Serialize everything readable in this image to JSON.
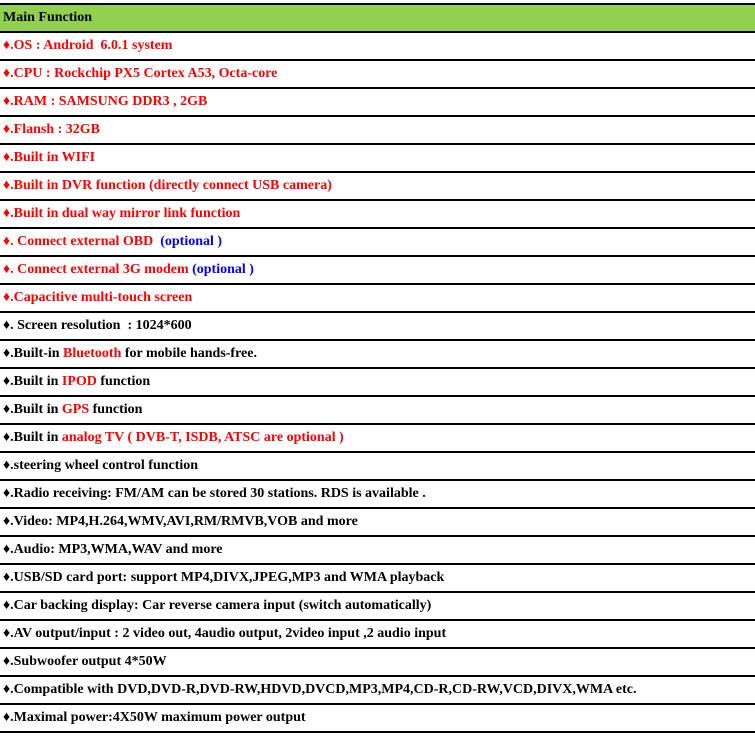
{
  "header": {
    "title": "Main Function",
    "background": "#92d050"
  },
  "colors": {
    "red": "#ff0000",
    "blue": "#0000ff",
    "black": "#000000"
  },
  "bullet": "♦",
  "rows": [
    {
      "segments": [
        {
          "text": "♦.OS : Android  6.0.1 system",
          "color": "red"
        }
      ]
    },
    {
      "segments": [
        {
          "text": "♦.CPU : Rockchip PX5 Cortex A53, Octa-core",
          "color": "red"
        }
      ]
    },
    {
      "segments": [
        {
          "text": "♦.RAM : SAMSUNG DDR3 , 2GB",
          "color": "red"
        }
      ]
    },
    {
      "segments": [
        {
          "text": "♦.Flansh : 32GB",
          "color": "red"
        }
      ]
    },
    {
      "segments": [
        {
          "text": "♦.Built in WIFI",
          "color": "red"
        }
      ]
    },
    {
      "segments": [
        {
          "text": "♦.Built in DVR function (directly connect USB camera)",
          "color": "red"
        }
      ]
    },
    {
      "segments": [
        {
          "text": "♦.Built in dual way mirror link function",
          "color": "red"
        }
      ]
    },
    {
      "segments": [
        {
          "text": "♦. Connect external OBD  ",
          "color": "red"
        },
        {
          "text": "(optional )",
          "color": "blue"
        }
      ]
    },
    {
      "segments": [
        {
          "text": "♦. Connect external 3G modem ",
          "color": "red"
        },
        {
          "text": "(optional )",
          "color": "blue"
        }
      ]
    },
    {
      "segments": [
        {
          "text": "♦.Capacitive multi-touch screen",
          "color": "red"
        }
      ]
    },
    {
      "segments": [
        {
          "text": "♦. Screen resolution  : 1024*600",
          "color": "black"
        }
      ]
    },
    {
      "segments": [
        {
          "text": "♦.Built-in ",
          "color": "black"
        },
        {
          "text": "Bluetooth",
          "color": "red"
        },
        {
          "text": " for mobile hands-free.",
          "color": "black"
        }
      ]
    },
    {
      "segments": [
        {
          "text": "♦.Built in ",
          "color": "black"
        },
        {
          "text": "IPOD",
          "color": "red"
        },
        {
          "text": " function",
          "color": "black"
        }
      ]
    },
    {
      "segments": [
        {
          "text": "♦.Built in ",
          "color": "black"
        },
        {
          "text": "GPS",
          "color": "red"
        },
        {
          "text": " function",
          "color": "black"
        }
      ]
    },
    {
      "segments": [
        {
          "text": "♦.Built in ",
          "color": "black"
        },
        {
          "text": "analog TV ( DVB-T, ISDB, ATSC are optional )",
          "color": "red"
        }
      ]
    },
    {
      "segments": [
        {
          "text": "♦.steering wheel control function",
          "color": "black"
        }
      ]
    },
    {
      "segments": [
        {
          "text": "♦.Radio receiving: FM/AM can be stored 30 stations. RDS is available .",
          "color": "black"
        }
      ]
    },
    {
      "segments": [
        {
          "text": "♦.Video: MP4,H.264,WMV,AVI,RM/RMVB,VOB and more",
          "color": "black"
        }
      ]
    },
    {
      "segments": [
        {
          "text": "♦.Audio: MP3,WMA,WAV and more",
          "color": "black"
        }
      ]
    },
    {
      "segments": [
        {
          "text": "♦.USB/SD card port: support MP4,DIVX,JPEG,MP3 and WMA playback",
          "color": "black"
        }
      ]
    },
    {
      "segments": [
        {
          "text": "♦.Car backing display: Car reverse camera input (switch automatically)",
          "color": "black"
        }
      ]
    },
    {
      "segments": [
        {
          "text": "♦.AV output/input : 2 video out, 4audio output, 2video input ,2 audio input",
          "color": "black"
        }
      ]
    },
    {
      "segments": [
        {
          "text": "♦.Subwoofer output 4*50W",
          "color": "black"
        }
      ]
    },
    {
      "segments": [
        {
          "text": "♦.Compatible with DVD,DVD-R,DVD-RW,HDVD,DVCD,MP3,MP4,CD-R,CD-RW,VCD,DIVX,WMA etc.",
          "color": "black"
        }
      ]
    },
    {
      "segments": [
        {
          "text": "♦.Maximal power:4X50W maximum power output",
          "color": "black"
        }
      ]
    }
  ]
}
